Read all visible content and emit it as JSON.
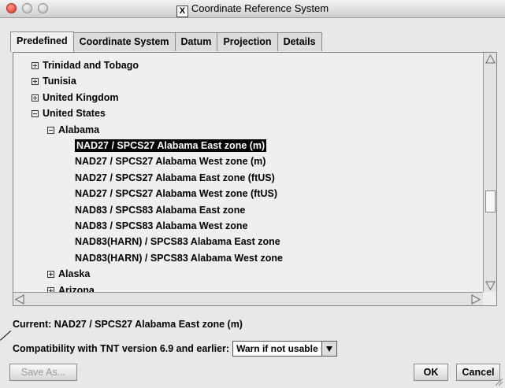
{
  "window": {
    "title": "Coordinate Reference System",
    "x_icon": "X"
  },
  "tabs": [
    {
      "label": "Predefined",
      "active": true
    },
    {
      "label": "Coordinate System",
      "active": false
    },
    {
      "label": "Datum",
      "active": false
    },
    {
      "label": "Projection",
      "active": false
    },
    {
      "label": "Details",
      "active": false
    }
  ],
  "tree": [
    {
      "label": "Trinidad and Tobago",
      "depth": 0,
      "expander": "plus"
    },
    {
      "label": "Tunisia",
      "depth": 0,
      "expander": "plus"
    },
    {
      "label": "United Kingdom",
      "depth": 0,
      "expander": "plus"
    },
    {
      "label": "United States",
      "depth": 0,
      "expander": "minus"
    },
    {
      "label": "Alabama",
      "depth": 1,
      "expander": "minus"
    },
    {
      "label": "NAD27 / SPCS27 Alabama East zone (m)",
      "depth": 2,
      "expander": "",
      "selected": true
    },
    {
      "label": "NAD27 / SPCS27 Alabama West zone (m)",
      "depth": 2,
      "expander": ""
    },
    {
      "label": "NAD27 / SPCS27 Alabama East zone (ftUS)",
      "depth": 2,
      "expander": ""
    },
    {
      "label": "NAD27 / SPCS27 Alabama West zone (ftUS)",
      "depth": 2,
      "expander": ""
    },
    {
      "label": "NAD83 / SPCS83 Alabama East zone",
      "depth": 2,
      "expander": ""
    },
    {
      "label": "NAD83 / SPCS83 Alabama West zone",
      "depth": 2,
      "expander": ""
    },
    {
      "label": "NAD83(HARN) / SPCS83 Alabama East zone",
      "depth": 2,
      "expander": ""
    },
    {
      "label": "NAD83(HARN) / SPCS83 Alabama West zone",
      "depth": 2,
      "expander": ""
    },
    {
      "label": "Alaska",
      "depth": 1,
      "expander": "plus"
    },
    {
      "label": "Arizona",
      "depth": 1,
      "expander": "plus"
    }
  ],
  "current": "Current: NAD27 / SPCS27 Alabama East zone (m)",
  "compat": {
    "label": "Compatibility with TNT version 6.9 and earlier:",
    "value": "Warn if not usable"
  },
  "buttons": {
    "save_as": "Save As...",
    "ok": "OK",
    "cancel": "Cancel"
  },
  "colors": {
    "selection_bg": "#000000",
    "selection_fg": "#ffffff"
  }
}
